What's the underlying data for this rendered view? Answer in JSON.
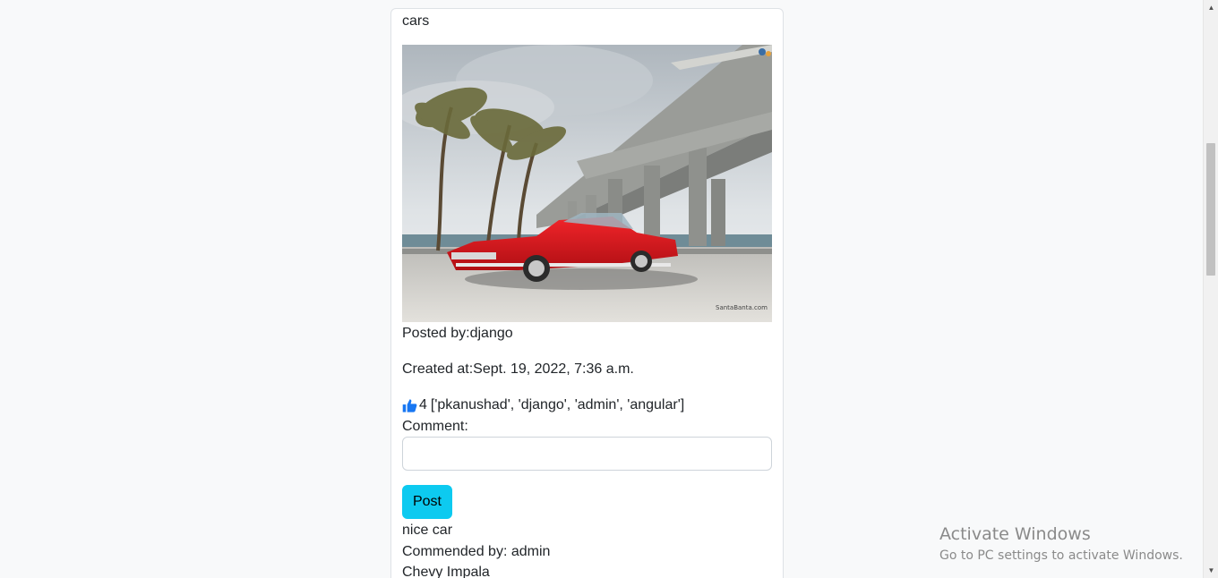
{
  "post": {
    "title": "cars",
    "image_alt": "red classic car under a bridge",
    "image_credit": "SantaBanta.com",
    "posted_by": "Posted by:django",
    "created_at": "Created at:Sept. 19, 2022, 7:36 a.m.",
    "like_count": "4",
    "liked_by": "['pkanushad', 'django', 'admin', 'angular']",
    "like_icon": "thumbs-up-icon",
    "comment_label": "Comment:",
    "comment_value": "",
    "post_button": "Post",
    "comments": [
      {
        "text": "nice car",
        "by": "Commended by: admin"
      }
    ]
  },
  "next_post": {
    "title": "Chevy Impala"
  },
  "watermark": {
    "title": "Activate Windows",
    "subtitle": "Go to PC settings to activate Windows."
  },
  "colors": {
    "page_bg": "#f8f9fa",
    "card_border": "#dee2e6",
    "post_button_bg": "#0dcaf0",
    "like_icon": "#1877f2"
  }
}
